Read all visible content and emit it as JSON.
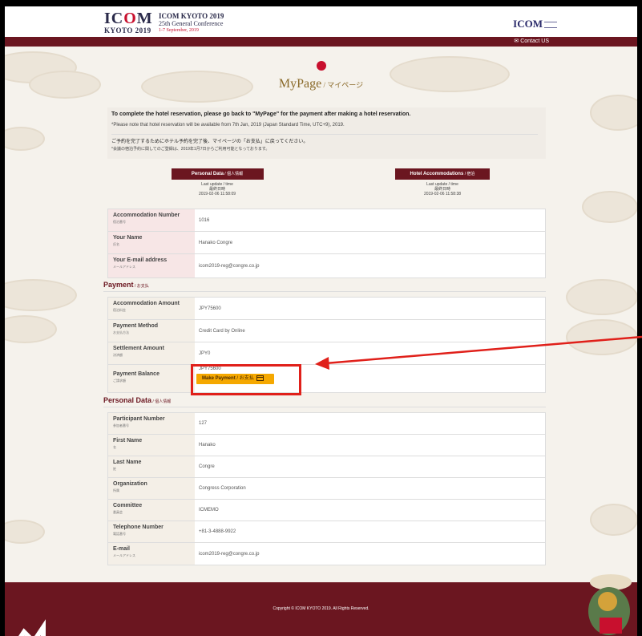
{
  "header": {
    "logo_icom": "IC",
    "logo_o": "O",
    "logo_m": "M",
    "logo_sub": "KYOTO 2019",
    "conf_title": "ICOM KYOTO 2019",
    "conf_sub": "25th General Conference",
    "conf_date": "1-7 September, 2019",
    "right_logo": "ICOM",
    "contact": "Contact US"
  },
  "title": {
    "en": "MyPage",
    "jp": " / マイページ"
  },
  "notice": {
    "line1": "To complete the hotel reservation, please go back to \"MyPage\" for the payment after making a hotel reservation.",
    "line2": "*Please note that hotel reservation will be available from 7th Jan, 2019 (Japan Standard Time, UTC+9), 2019.",
    "line3": "ご予約を完了するためにホテル予約を完了後、マイページの「お支払」に戻ってください。",
    "line4": "*会議の宿泊予約に関してのご登録は、2019年1月7日からご利用可能となっております。"
  },
  "tabs": [
    {
      "label": "Personal Data",
      "jp": " / 個人情報",
      "upd1": "Last update / time",
      "upd2": "最終日時",
      "upd3": "2019-02-06 11:58:09"
    },
    {
      "label": "Hotel Accommodations",
      "jp": " / 宿泊",
      "upd1": "Last update / time",
      "upd2": "最終日時",
      "upd3": "2019-02-06 11:58:38"
    }
  ],
  "accommodation": {
    "rows": [
      {
        "en": "Accommodation Number",
        "jp": "宿泊番号",
        "value": "1016"
      },
      {
        "en": "Your Name",
        "jp": "氏名",
        "value": "Hanako Congre"
      },
      {
        "en": "Your E-mail address",
        "jp": "メールアドレス",
        "value": "icom2019-reg@congre.co.jp"
      }
    ]
  },
  "payment": {
    "title": "Payment",
    "title_jp": " / お支払",
    "rows": [
      {
        "en": "Accommodation Amount",
        "jp": "宿泊料金",
        "value": "JPY75600"
      },
      {
        "en": "Payment Method",
        "jp": "お支払方法",
        "value": "Credit Card by Online"
      },
      {
        "en": "Settlement Amount",
        "jp": "決済額",
        "value": "JPY0"
      },
      {
        "en": "Payment Balance",
        "jp": "ご請求額",
        "value": "JPY75600"
      }
    ],
    "button_label": "Make Payment",
    "button_jp": " / お支払"
  },
  "personal": {
    "title": "Personal Data",
    "title_jp": " / 個人情報",
    "rows": [
      {
        "en": "Participant Number",
        "jp": "参加者番号",
        "value": "127"
      },
      {
        "en": "First Name",
        "jp": "名",
        "value": "Hanako"
      },
      {
        "en": "Last Name",
        "jp": "姓",
        "value": "Congre"
      },
      {
        "en": "Organization",
        "jp": "所属",
        "value": "Congress Corporation"
      },
      {
        "en": "Committee",
        "jp": "委員会",
        "value": "ICMEMO"
      },
      {
        "en": "Telephone Number",
        "jp": "電話番号",
        "value": "+81-3-4888-9922"
      },
      {
        "en": "E-mail",
        "jp": "メールアドレス",
        "value": "icom2019-reg@congre.co.jp"
      }
    ]
  },
  "footer": {
    "copyright": "Copyright © ICOM KYOTO 2019. All Rights Reserved."
  },
  "colors": {
    "brand": "#6b1620",
    "accent": "#f5a800",
    "highlight": "#e0201a"
  }
}
